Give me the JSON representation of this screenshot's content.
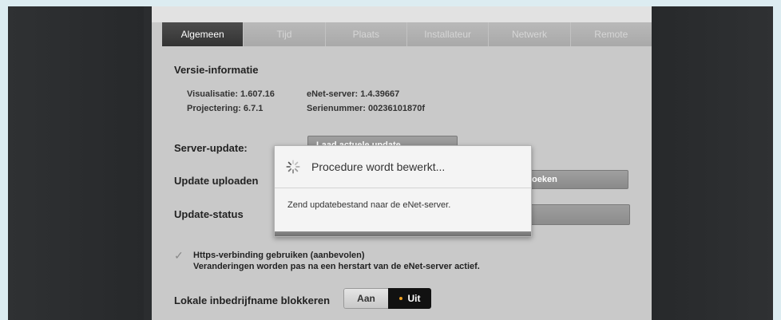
{
  "tabs": [
    {
      "label": "Algemeen",
      "active": true
    },
    {
      "label": "Tijd",
      "active": false
    },
    {
      "label": "Plaats",
      "active": false
    },
    {
      "label": "Installateur",
      "active": false
    },
    {
      "label": "Netwerk",
      "active": false
    },
    {
      "label": "Remote",
      "active": false
    }
  ],
  "version": {
    "title": "Versie-informatie",
    "visualisatie": "Visualisatie: 1.607.16",
    "projectering": "Projectering: 6.7.1",
    "enet_server": "eNet-server: 1.4.39667",
    "serienummer": "Serienummer: 00236101870f"
  },
  "server_update": {
    "label": "Server-update:",
    "button_label": "Laad actuele update"
  },
  "update_upload": {
    "label": "Update uploaden",
    "button_label": "oeken"
  },
  "update_status": {
    "label": "Update-status"
  },
  "https": {
    "checked": true,
    "line1": "Https-verbinding gebruiken (aanbevolen)",
    "line2": "Veranderingen worden pas na een herstart van de eNet-server actief."
  },
  "local": {
    "label": "Lokale inbedrijfname blokkeren",
    "on_label": "Aan",
    "off_label": "Uit",
    "selected": "Uit"
  },
  "modal": {
    "title": "Procedure wordt bewerkt...",
    "message": "Zend updatebestand naar de eNet-server.",
    "icon": "spinner-icon"
  },
  "colors": {
    "active_tab": "#3a3a3a",
    "toggle_selected": "#111111",
    "toggle_dot": "#f0a020"
  }
}
